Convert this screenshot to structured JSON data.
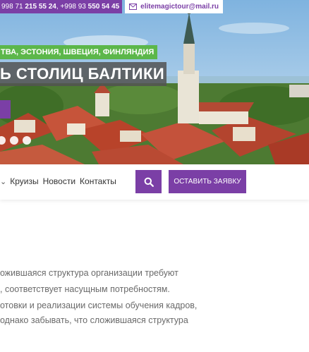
{
  "topbar": {
    "phone_prefix_1": "998 71 ",
    "phone_bold_1": "215 55 24",
    "phone_prefix_2": ", +998 93 ",
    "phone_bold_2": "550 54 45",
    "email": "elitemagictour@mail.ru",
    "email_icon": "envelope-icon"
  },
  "hero": {
    "tagline": "ТВА, ЭСТОНИЯ, ШВЕЦИЯ, ФИНЛЯНДИЯ",
    "headline": "Ь СТОЛИЦ БАЛТИКИ",
    "slide_count": 4
  },
  "nav": {
    "items": [
      "Круизы",
      "Новости",
      "Контакты"
    ],
    "chevron_icon": "chevron-down-icon",
    "search_icon": "search-icon",
    "cta_label": "ОСТАВИТЬ ЗАЯВКУ"
  },
  "content": {
    "lines": [
      "ожившаяся структура организации требуют",
      ", соответствует насущным потребностям.",
      "отовки и реализации системы обучения кадров,",
      "однако забывать, что сложившаяся структура"
    ]
  },
  "colors": {
    "brand_purple": "#7b3fa6",
    "tag_green": "#5cb74a",
    "headline_bg": "#525252"
  }
}
